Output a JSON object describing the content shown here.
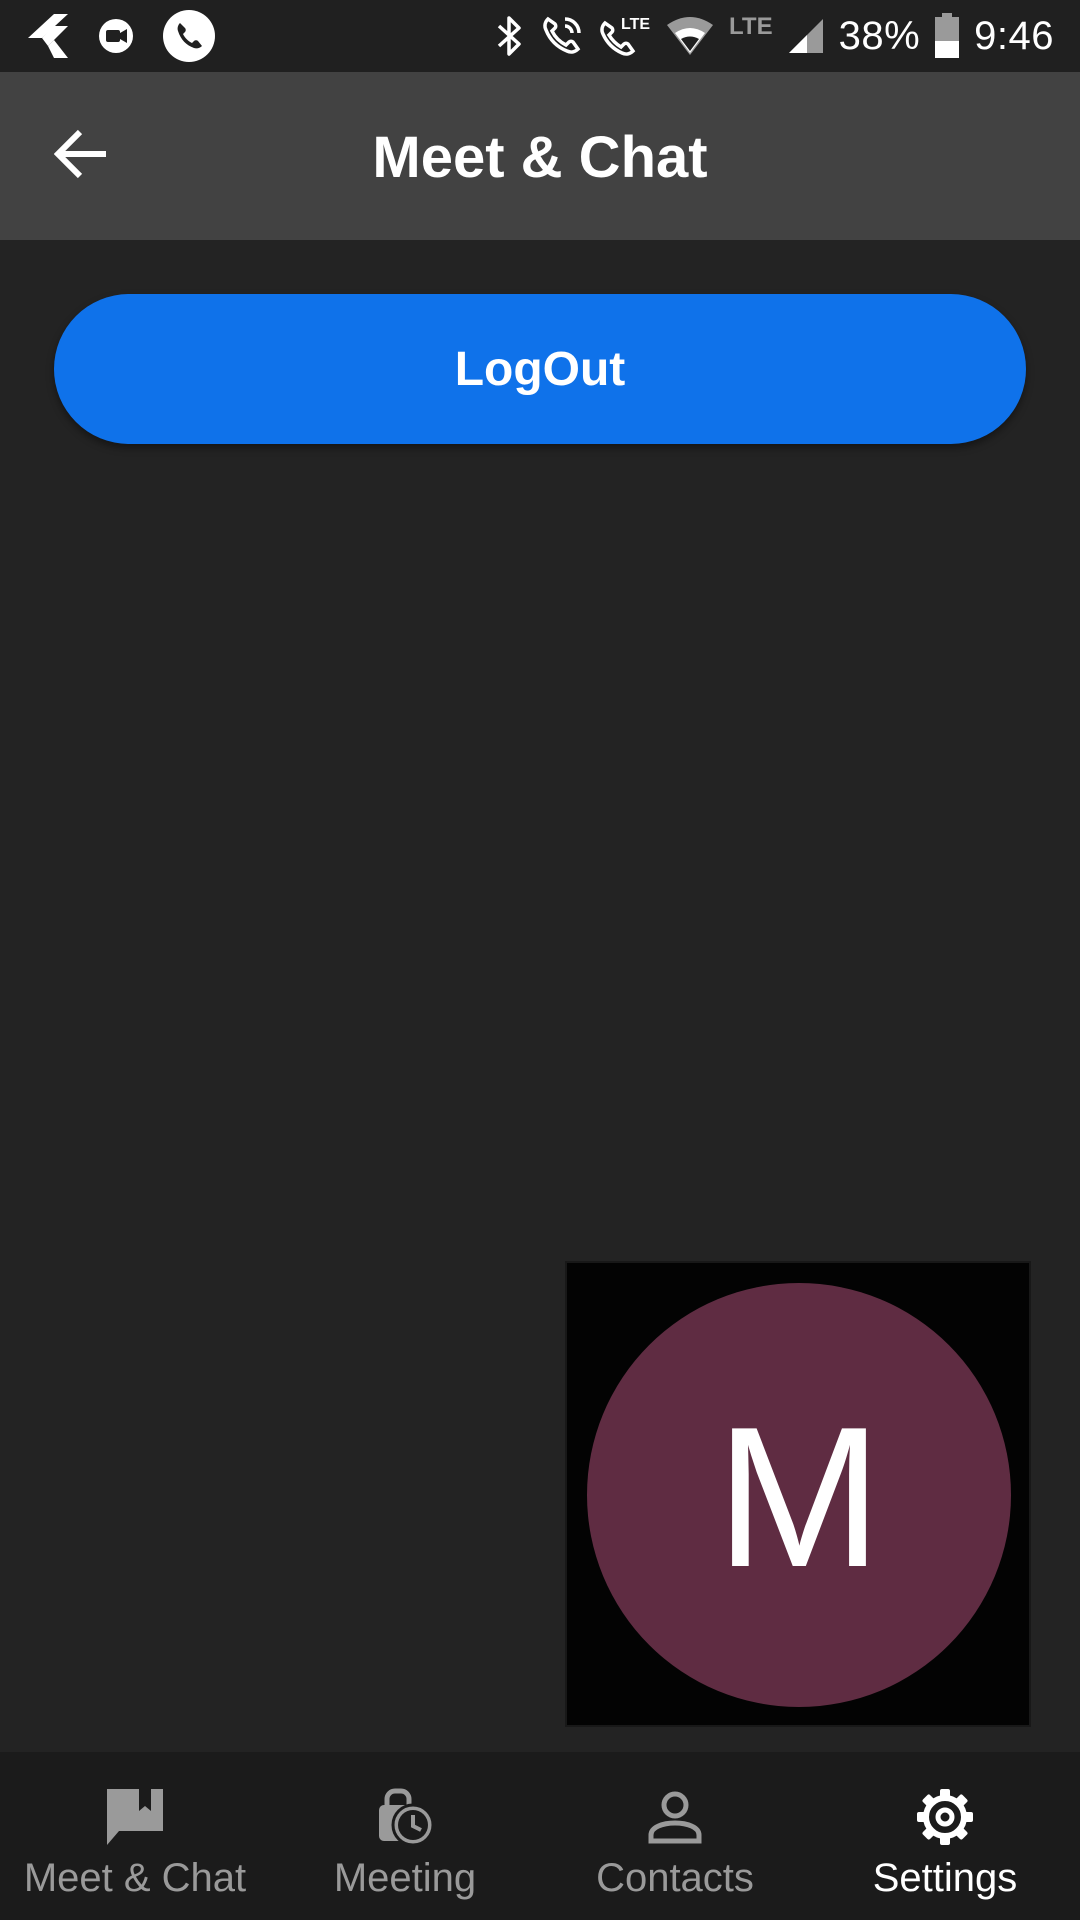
{
  "status_bar": {
    "battery_percent": "38%",
    "time": "9:46",
    "lte_label": "LTE",
    "icons": [
      "flutter-icon",
      "video-call-notification-icon",
      "phone-notification-icon",
      "bluetooth-icon",
      "wifi-calling-icon",
      "lte-call-icon",
      "wifi-icon",
      "signal-icon",
      "battery-icon"
    ]
  },
  "app_bar": {
    "title": "Meet & Chat",
    "back_icon": "arrow-back-icon"
  },
  "main": {
    "logout_label": "LogOut"
  },
  "self_view": {
    "avatar_initial": "M",
    "avatar_color": "#5f2c42"
  },
  "bottom_nav": {
    "items": [
      {
        "label": "Meet & Chat",
        "icon": "chat-bookmark-icon",
        "active": false
      },
      {
        "label": "Meeting",
        "icon": "meeting-clock-icon",
        "active": false
      },
      {
        "label": "Contacts",
        "icon": "person-icon",
        "active": false
      },
      {
        "label": "Settings",
        "icon": "gear-icon",
        "active": true
      }
    ]
  },
  "colors": {
    "background": "#232323",
    "app_bar": "#424242",
    "accent": "#0f72ea",
    "nav_background": "#1b1b1b",
    "nav_inactive": "#9a9a9a",
    "nav_active": "#ffffff"
  }
}
